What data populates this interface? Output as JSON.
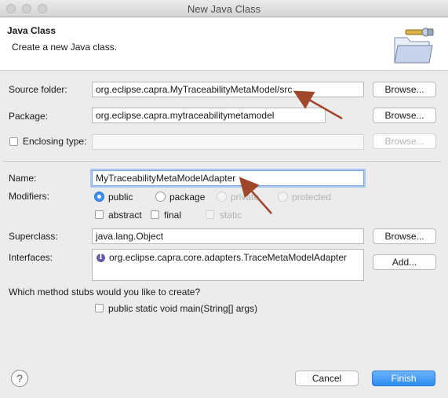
{
  "window": {
    "title": "New Java Class"
  },
  "header": {
    "title": "Java Class",
    "subtitle": "Create a new Java class."
  },
  "form": {
    "source_folder": {
      "label": "Source folder:",
      "value": "org.eclipse.capra.MyTraceabilityMetaModel/src",
      "button": "Browse..."
    },
    "package": {
      "label": "Package:",
      "value": "org.eclipse.capra.mytraceabilitymetamodel",
      "button": "Browse..."
    },
    "enclosing_type": {
      "label": "Enclosing type:",
      "value": "",
      "button": "Browse...",
      "checked": false
    },
    "name": {
      "label": "Name:",
      "value": "MyTraceabilityMetaModelAdapter"
    },
    "modifiers": {
      "label": "Modifiers:",
      "access": [
        {
          "label": "public",
          "selected": true,
          "enabled": true
        },
        {
          "label": "package",
          "selected": false,
          "enabled": true
        },
        {
          "label": "private",
          "selected": false,
          "enabled": false
        },
        {
          "label": "protected",
          "selected": false,
          "enabled": false
        }
      ],
      "flags": [
        {
          "label": "abstract",
          "checked": false,
          "enabled": true
        },
        {
          "label": "final",
          "checked": false,
          "enabled": true
        },
        {
          "label": "static",
          "checked": false,
          "enabled": false
        }
      ]
    },
    "superclass": {
      "label": "Superclass:",
      "value": "java.lang.Object",
      "button": "Browse..."
    },
    "interfaces": {
      "label": "Interfaces:",
      "items": [
        "org.eclipse.capra.core.adapters.TraceMetaModelAdapter"
      ],
      "button": "Add..."
    },
    "stubs": {
      "question": "Which method stubs would you like to create?",
      "main_label": "public static void main(String[] args)",
      "main_checked": false
    }
  },
  "footer": {
    "help_glyph": "?",
    "cancel": "Cancel",
    "finish": "Finish"
  },
  "colors": {
    "annotation_arrow": "#a0462a",
    "primary_button": "#2a8cf3",
    "interface_icon": "#6b5aa8"
  }
}
